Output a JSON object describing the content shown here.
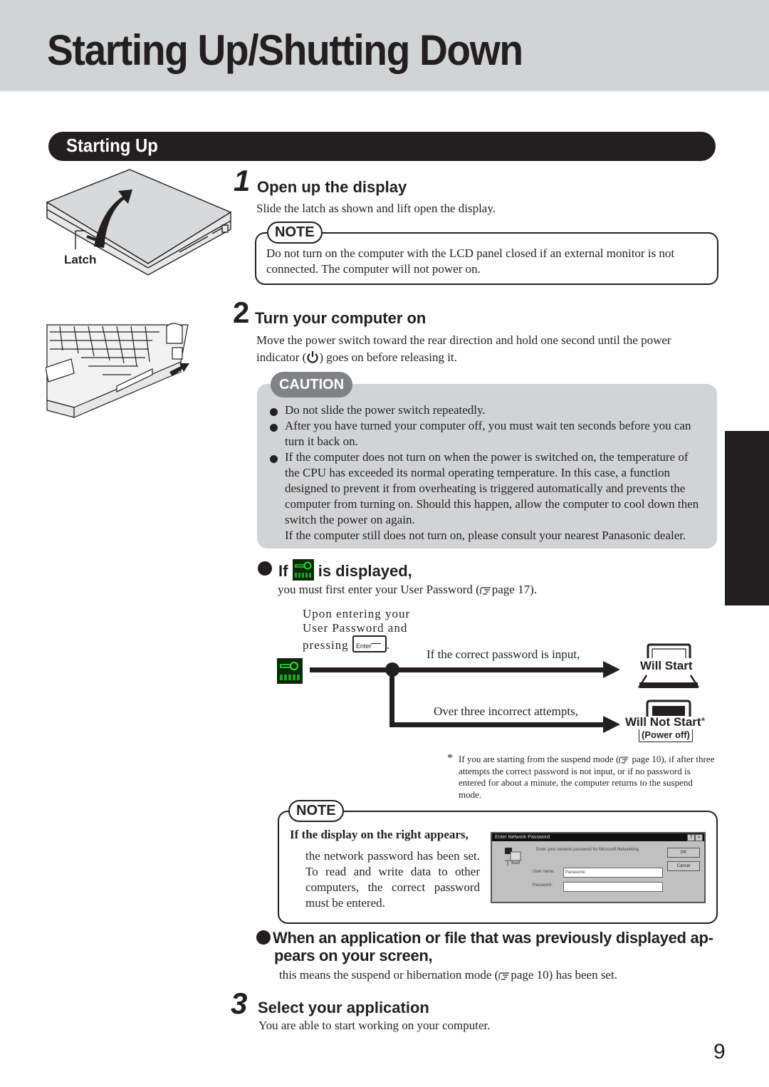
{
  "page": {
    "title": "Starting Up/Shutting Down",
    "section_title": "Starting Up",
    "page_number": "9"
  },
  "illustrations": {
    "latch_label": "Latch"
  },
  "step1": {
    "number": "1",
    "heading": "Open up the display",
    "text": "Slide the latch as shown and lift open the display.",
    "note_label": "NOTE",
    "note_text": "Do not turn on the computer with the LCD panel closed if an external monitor is not connected. The computer will not power on."
  },
  "step2": {
    "number": "2",
    "heading": "Turn your computer on",
    "text_line1": "Move the power switch toward the rear direction and hold one second until the power",
    "text_line2_before": "indicator (",
    "text_line2_after": ") goes on before releasing it.",
    "power_icon": "power-icon",
    "caution_label": "CAUTION",
    "caution_items": [
      "Do not slide the power switch repeatedly.",
      "After you have turned your computer off, you must wait ten seconds before you can turn it back on.",
      "If the computer does not turn on when the power is switched on, the temperature of the CPU has exceeded its normal operating temperature. In this case, a function designed to prevent it from overheating is triggered automatically and prevents the computer from turning on. Should this happen, allow the computer to cool down then switch the power on again."
    ],
    "caution_extra": "If the computer still does not turn on, please consult your nearest Panasonic dealer."
  },
  "password": {
    "heading_before": "If",
    "heading_after": "is displayed,",
    "key_icon": "password-key-icon",
    "text_before": "you must first enter your User Password (",
    "text_ref": "page 17).",
    "flow_intro_l1": "Upon entering your",
    "flow_intro_l2": "User Password and",
    "flow_intro_l3": "pressing",
    "enter_key_label": "Enter",
    "flow_intro_end": ".",
    "correct_label": "If the correct password is input,",
    "correct_result": "Will Start",
    "incorrect_label": "Over three incorrect attempts,",
    "incorrect_result": "Will Not Start",
    "incorrect_asterisk": "*",
    "incorrect_sub": "(Power off)",
    "footnote_mark": "*",
    "footnote_before": "If you are starting from the suspend mode (",
    "footnote_ref": "page 10), if",
    "footnote_rest": "after three attempts the correct password is not input, or if no password is entered for about a minute, the computer returns to the suspend mode."
  },
  "network_note": {
    "label": "NOTE",
    "heading": "If the display on the right appears,",
    "text": "the network password has been set. To read and write data to other computers, the correct password must be entered.",
    "dialog": {
      "title": "Enter Network Password",
      "prompt": "Enter your network password for Microsoft Networking",
      "username_label": "User name:",
      "username_value": "Panasonic",
      "password_label": "Password:",
      "password_value": "",
      "ok_label": "OK",
      "cancel_label": "Cancel",
      "help_glyph": "?",
      "close_glyph": "×"
    }
  },
  "resume": {
    "heading_l1": "When an application or file that was previously displayed ap-",
    "heading_l2": "pears on your screen,",
    "text_before": "this means the suspend or hibernation mode (",
    "text_ref": "page 10) has been set."
  },
  "step3": {
    "number": "3",
    "heading": "Select your application",
    "text": "You are able to start working on your computer."
  },
  "colors": {
    "ink": "#231f20",
    "header_gray": "#d1d3d4",
    "caution_gray": "#808285",
    "key_green": "#22c322"
  }
}
